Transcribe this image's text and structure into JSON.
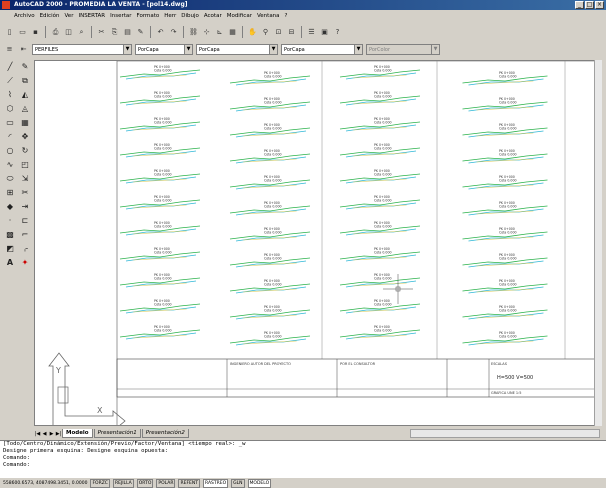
{
  "window": {
    "title": "AutoCAD 2000 - PROMEDIA LA VENTA - [pol14.dwg]"
  },
  "menu": [
    "Archivo",
    "Edición",
    "Ver",
    "INSERTAR",
    "Insertar",
    "Formato",
    "Herr",
    "Dibujo",
    "Acotar",
    "Modificar",
    "Ventana",
    "?"
  ],
  "toolbar2": {
    "layer": "PERFILES",
    "color": "PorCapa",
    "linetype": "PorCapa",
    "lineweight": "PorCapa",
    "plotstyle": "PorColor"
  },
  "drawing": {
    "section_label": "PK 0+000",
    "section_sub": "Cota 0.000",
    "title_block": {
      "cell1": "INGENIERO AUTOR DEL PROYECTO",
      "cell2": "POR EL CONSULTOR",
      "cell3": "ESCALAS",
      "scale_text": "H=500 V=500",
      "grafica": "GRAFICA UNE 1:5"
    },
    "ucs_x": "X",
    "ucs_y": "Y"
  },
  "tabs": [
    "Modelo",
    "Presentación1",
    "Presentación2"
  ],
  "command_lines": [
    "[Todo/Centro/Dinámico/Extensión/Previo/Factor/Ventana] <tiempo real>: _w",
    "Designe primera esquina:  Designe esquina opuesta:",
    "Comando:",
    "Comando:"
  ],
  "status": {
    "coords": "558600.6573, 4087498.3451, 0.0000",
    "toggles": [
      "FORZC",
      "REJILLA",
      "ORTO",
      "POLAR",
      "REFENT",
      "RASTREO",
      "GLN",
      "MODELO"
    ]
  },
  "icons": {
    "app": "autocad-icon",
    "min": "minimize-icon",
    "max": "maximize-icon",
    "close": "close-icon"
  }
}
